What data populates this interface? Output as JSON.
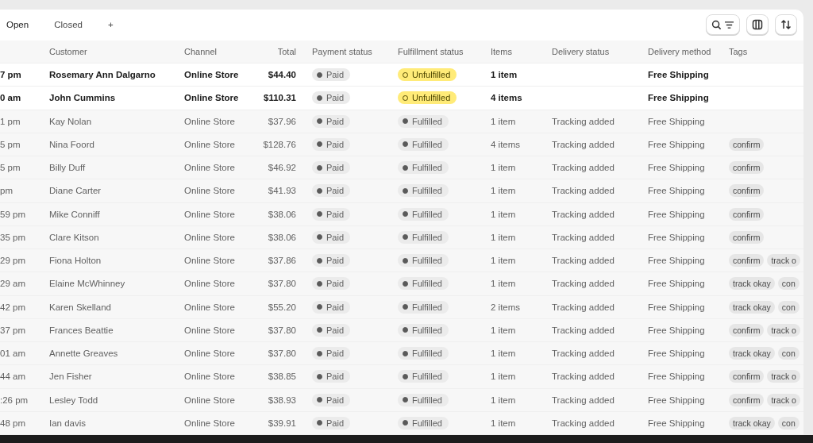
{
  "tabs": [
    {
      "label": "Open",
      "selected": true
    },
    {
      "label": "Closed",
      "selected": false
    }
  ],
  "add_tab": "+",
  "columns": [
    "Customer",
    "Channel",
    "Total",
    "Payment status",
    "Fulfillment status",
    "Items",
    "Delivery status",
    "Delivery method",
    "Tags"
  ],
  "rows": [
    {
      "date": "7 pm",
      "customer": "Rosemary Ann Dalgarno",
      "channel": "Online Store",
      "total": "$44.40",
      "payment": "Paid",
      "fulfillment": {
        "kind": "unfulfilled",
        "label": "Unfulfilled"
      },
      "items": "1 item",
      "delivery_method": "Free Shipping",
      "unread": true,
      "tags": []
    },
    {
      "date": "0 am",
      "customer": "John Cummins",
      "channel": "Online Store",
      "total": "$110.31",
      "payment": "Paid",
      "fulfillment": {
        "kind": "unfulfilled",
        "label": "Unfulfilled"
      },
      "items": "4 items",
      "delivery_method": "Free Shipping",
      "unread": true,
      "tags": []
    },
    {
      "date": "1 pm",
      "customer": "Kay Nolan",
      "channel": "Online Store",
      "total": "$37.96",
      "payment": "Paid",
      "fulfillment": {
        "kind": "fulfilled",
        "label": "Fulfilled"
      },
      "items": "1 item",
      "delivery_status": "Tracking added",
      "delivery_method": "Free Shipping",
      "unread": false,
      "tags": []
    },
    {
      "date": "5 pm",
      "customer": "Nina Foord",
      "channel": "Online Store",
      "total": "$128.76",
      "payment": "Paid",
      "fulfillment": {
        "kind": "fulfilled",
        "label": "Fulfilled"
      },
      "items": "4 items",
      "delivery_status": "Tracking added",
      "delivery_method": "Free Shipping",
      "unread": false,
      "tags": [
        "confirm"
      ]
    },
    {
      "date": "5 pm",
      "customer": "Billy Duff",
      "channel": "Online Store",
      "total": "$46.92",
      "payment": "Paid",
      "fulfillment": {
        "kind": "fulfilled",
        "label": "Fulfilled"
      },
      "items": "1 item",
      "delivery_status": "Tracking added",
      "delivery_method": "Free Shipping",
      "unread": false,
      "tags": [
        "confirm"
      ]
    },
    {
      "date": "pm",
      "customer": "Diane Carter",
      "channel": "Online Store",
      "total": "$41.93",
      "payment": "Paid",
      "fulfillment": {
        "kind": "fulfilled",
        "label": "Fulfilled"
      },
      "items": "1 item",
      "delivery_status": "Tracking added",
      "delivery_method": "Free Shipping",
      "unread": false,
      "tags": [
        "confirm"
      ]
    },
    {
      "date": "59 pm",
      "customer": "Mike Conniff",
      "channel": "Online Store",
      "total": "$38.06",
      "payment": "Paid",
      "fulfillment": {
        "kind": "fulfilled",
        "label": "Fulfilled"
      },
      "items": "1 item",
      "delivery_status": "Tracking added",
      "delivery_method": "Free Shipping",
      "unread": false,
      "tags": [
        "confirm"
      ]
    },
    {
      "date": "35 pm",
      "customer": "Clare Kitson",
      "channel": "Online Store",
      "total": "$38.06",
      "payment": "Paid",
      "fulfillment": {
        "kind": "fulfilled",
        "label": "Fulfilled"
      },
      "items": "1 item",
      "delivery_status": "Tracking added",
      "delivery_method": "Free Shipping",
      "unread": false,
      "tags": [
        "confirm"
      ]
    },
    {
      "date": "29 pm",
      "customer": "Fiona Holton",
      "channel": "Online Store",
      "total": "$37.86",
      "payment": "Paid",
      "fulfillment": {
        "kind": "fulfilled",
        "label": "Fulfilled"
      },
      "items": "1 item",
      "delivery_status": "Tracking added",
      "delivery_method": "Free Shipping",
      "unread": false,
      "tags": [
        "confirm",
        "track o"
      ]
    },
    {
      "date": "29 am",
      "customer": "Elaine McWhinney",
      "channel": "Online Store",
      "total": "$37.80",
      "payment": "Paid",
      "fulfillment": {
        "kind": "fulfilled",
        "label": "Fulfilled"
      },
      "items": "1 item",
      "delivery_status": "Tracking added",
      "delivery_method": "Free Shipping",
      "unread": false,
      "tags": [
        "track okay",
        "con"
      ]
    },
    {
      "date": "42 pm",
      "customer": "Karen Skelland",
      "channel": "Online Store",
      "total": "$55.20",
      "payment": "Paid",
      "fulfillment": {
        "kind": "fulfilled",
        "label": "Fulfilled"
      },
      "items": "2 items",
      "delivery_status": "Tracking added",
      "delivery_method": "Free Shipping",
      "unread": false,
      "tags": [
        "track okay",
        "con"
      ]
    },
    {
      "date": "37 pm",
      "customer": "Frances Beattie",
      "channel": "Online Store",
      "total": "$37.80",
      "payment": "Paid",
      "fulfillment": {
        "kind": "fulfilled",
        "label": "Fulfilled"
      },
      "items": "1 item",
      "delivery_status": "Tracking added",
      "delivery_method": "Free Shipping",
      "unread": false,
      "tags": [
        "confirm",
        "track o"
      ]
    },
    {
      "date": "01 am",
      "customer": "Annette Greaves",
      "channel": "Online Store",
      "total": "$37.80",
      "payment": "Paid",
      "fulfillment": {
        "kind": "fulfilled",
        "label": "Fulfilled"
      },
      "items": "1 item",
      "delivery_status": "Tracking added",
      "delivery_method": "Free Shipping",
      "unread": false,
      "tags": [
        "track okay",
        "con"
      ]
    },
    {
      "date": "44 am",
      "customer": "Jen Fisher",
      "channel": "Online Store",
      "total": "$38.85",
      "payment": "Paid",
      "fulfillment": {
        "kind": "fulfilled",
        "label": "Fulfilled"
      },
      "items": "1 item",
      "delivery_status": "Tracking added",
      "delivery_method": "Free Shipping",
      "unread": false,
      "tags": [
        "confirm",
        "track o"
      ]
    },
    {
      "date": ":26 pm",
      "customer": "Lesley Todd",
      "channel": "Online Store",
      "total": "$38.93",
      "payment": "Paid",
      "fulfillment": {
        "kind": "fulfilled",
        "label": "Fulfilled"
      },
      "items": "1 item",
      "delivery_status": "Tracking added",
      "delivery_method": "Free Shipping",
      "unread": false,
      "tags": [
        "confirm",
        "track o"
      ]
    },
    {
      "date": "48 pm",
      "customer": "Ian davis",
      "channel": "Online Store",
      "total": "$39.91",
      "payment": "Paid",
      "fulfillment": {
        "kind": "fulfilled",
        "label": "Fulfilled"
      },
      "items": "1 item",
      "delivery_status": "Tracking added",
      "delivery_method": "Free Shipping",
      "unread": false,
      "tags": [
        "track okay",
        "con"
      ]
    }
  ]
}
